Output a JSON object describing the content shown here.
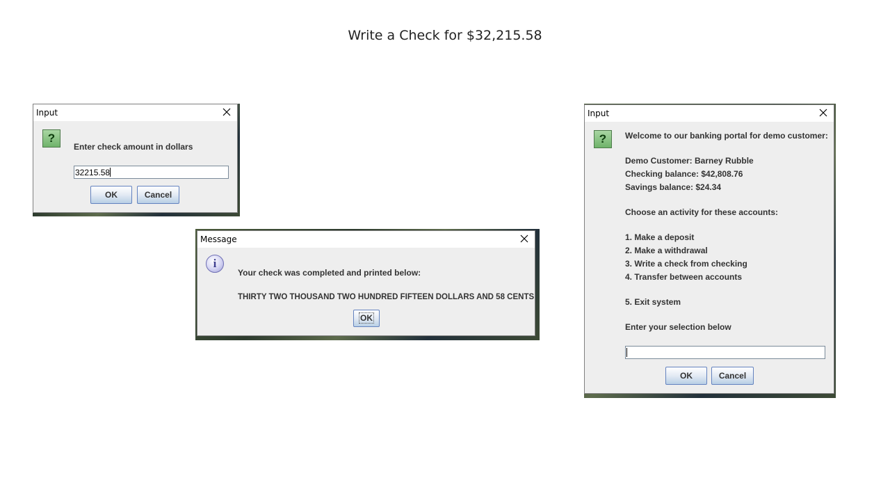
{
  "slide": {
    "title": "Write a Check for $32,215.58"
  },
  "dialog_amount": {
    "title": "Input",
    "icon": "question-icon",
    "prompt": "Enter check amount in dollars",
    "input_value": "32215.58",
    "ok_label": "OK",
    "cancel_label": "Cancel"
  },
  "dialog_message": {
    "title": "Message",
    "icon": "info-icon",
    "line1": "Your check was completed and printed below:",
    "line2": "THIRTY TWO THOUSAND TWO HUNDRED FIFTEEN DOLLARS AND 58 CENTS",
    "ok_label": "OK"
  },
  "dialog_menu": {
    "title": "Input",
    "icon": "question-icon",
    "welcome": "Welcome to our banking portal for demo customer:",
    "customer": "Demo Customer:  Barney Rubble",
    "checking": "Checking balance: $42,808.76",
    "savings": "Savings balance:  $24.34",
    "choose": "Choose an activity for these accounts:",
    "options": [
      "1.  Make a deposit",
      "2.  Make a withdrawal",
      "3.  Write a check from checking",
      "4.  Transfer between accounts",
      "5.  Exit system"
    ],
    "enter": "Enter your selection below",
    "input_value": "",
    "ok_label": "OK",
    "cancel_label": "Cancel"
  }
}
